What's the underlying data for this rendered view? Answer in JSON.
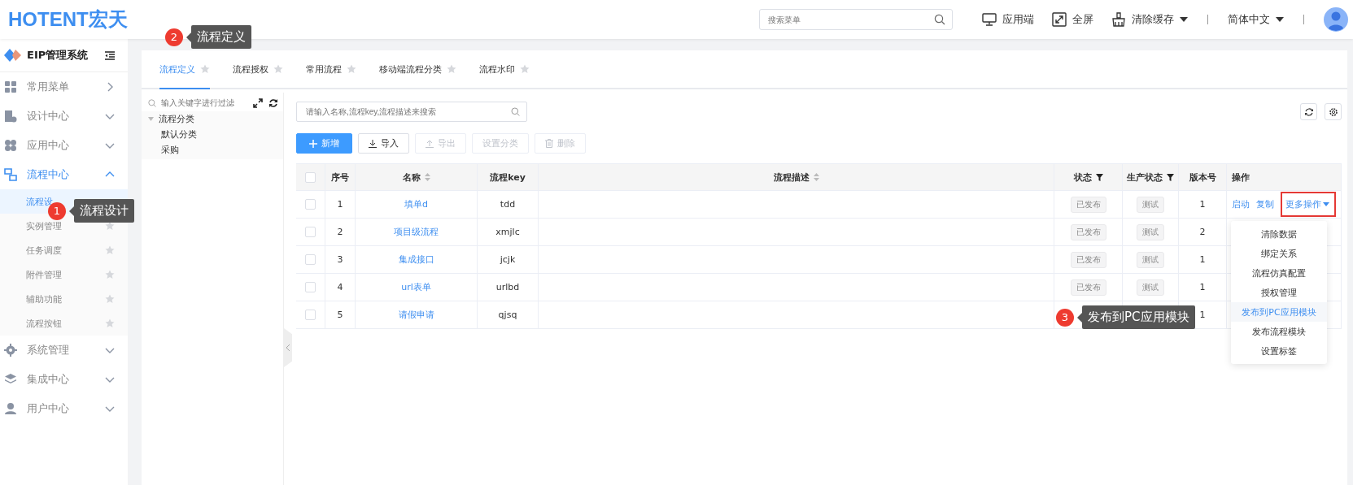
{
  "header": {
    "logo": "HOTENT宏天",
    "search": {
      "placeholder": "搜索菜单"
    },
    "actions": [
      {
        "kind": "monitor",
        "label": "应用端",
        "caret": false
      },
      {
        "kind": "fullscreen",
        "label": "全屏",
        "caret": false
      },
      {
        "kind": "broom",
        "label": "清除缓存",
        "caret": true
      },
      {
        "kind": "language",
        "label": "简体中文",
        "caret": true
      }
    ]
  },
  "sidebar": {
    "title": "EIP管理系统",
    "items": [
      {
        "kind": "link",
        "label": "常用菜单",
        "expanded": false,
        "selected": false
      },
      {
        "kind": "group",
        "label": "设计中心",
        "expanded": false,
        "selected": false
      },
      {
        "kind": "group",
        "label": "应用中心",
        "expanded": false,
        "selected": false
      },
      {
        "kind": "group",
        "label": "流程中心",
        "expanded": true,
        "selected": true,
        "children": [
          {
            "label": "流程设",
            "selected": true,
            "star": false
          },
          {
            "label": "实例管理",
            "selected": false,
            "star": true
          },
          {
            "label": "任务调度",
            "selected": false,
            "star": true
          },
          {
            "label": "附件管理",
            "selected": false,
            "star": true
          },
          {
            "label": "辅助功能",
            "selected": false,
            "star": true
          },
          {
            "label": "流程按钮",
            "selected": false,
            "star": true
          }
        ]
      },
      {
        "kind": "group",
        "label": "系统管理",
        "expanded": false,
        "selected": false
      },
      {
        "kind": "group",
        "label": "集成中心",
        "expanded": false,
        "selected": false
      },
      {
        "kind": "group",
        "label": "用户中心",
        "expanded": false,
        "selected": false
      }
    ]
  },
  "tabs": [
    {
      "label": "流程定义",
      "selected": true
    },
    {
      "label": "流程授权",
      "selected": false
    },
    {
      "label": "常用流程",
      "selected": false
    },
    {
      "label": "移动端流程分类",
      "selected": false
    },
    {
      "label": "流程水印",
      "selected": false
    }
  ],
  "tree": {
    "placeholder": "输入关键字进行过滤",
    "nodes": [
      {
        "label": "流程分类",
        "expanded": true,
        "children": [
          {
            "label": "默认分类"
          },
          {
            "label": "采购"
          }
        ]
      }
    ]
  },
  "search": {
    "placeholder": "请输入名称,流程key,流程描述来搜索"
  },
  "toolbar": [
    {
      "kind": "add",
      "label": "新增",
      "primary": true,
      "disabled": false
    },
    {
      "kind": "import",
      "label": "导入",
      "primary": false,
      "disabled": false
    },
    {
      "kind": "export",
      "label": "导出",
      "primary": false,
      "disabled": true
    },
    {
      "kind": "plain",
      "label": "设置分类",
      "primary": false,
      "disabled": true
    },
    {
      "kind": "delete",
      "label": "删除",
      "primary": false,
      "disabled": true
    }
  ],
  "table": {
    "all_checked": false,
    "columns": [
      {
        "label": "序号",
        "sortable": false,
        "filter": false
      },
      {
        "label": "名称",
        "sortable": true,
        "filter": false
      },
      {
        "label": "流程key",
        "sortable": false,
        "filter": false
      },
      {
        "label": "流程描述",
        "sortable": true,
        "filter": false
      },
      {
        "label": "状态",
        "sortable": false,
        "filter": true
      },
      {
        "label": "生产状态",
        "sortable": false,
        "filter": true
      },
      {
        "label": "版本号",
        "sortable": false,
        "filter": false
      },
      {
        "label": "操作",
        "sortable": false,
        "filter": false
      }
    ],
    "rows": [
      {
        "checked": false,
        "no": "1",
        "name": "填单d",
        "key": "tdd",
        "status": "已发布",
        "prod": "测试",
        "version": "1",
        "ops": [
          "启动",
          "复制"
        ],
        "more": "更多操作"
      },
      {
        "checked": false,
        "no": "2",
        "name": "项目级流程",
        "key": "xmjlc",
        "status": "已发布",
        "prod": "测试",
        "version": "2"
      },
      {
        "checked": false,
        "no": "3",
        "name": "集成接口",
        "key": "jcjk",
        "status": "已发布",
        "prod": "测试",
        "version": "1"
      },
      {
        "checked": false,
        "no": "4",
        "name": "url表单",
        "key": "urlbd",
        "status": "已发布",
        "prod": "测试",
        "version": "1"
      },
      {
        "checked": false,
        "no": "5",
        "name": "请假申请",
        "key": "qjsq",
        "version": "1"
      }
    ]
  },
  "dropdown": [
    {
      "label": "清除数据",
      "selected": false
    },
    {
      "label": "绑定关系",
      "selected": false
    },
    {
      "label": "流程仿真配置",
      "selected": false
    },
    {
      "label": "授权管理",
      "selected": false
    },
    {
      "label": "发布到PC应用模块",
      "selected": true
    },
    {
      "label": "发布流程模块",
      "selected": false
    },
    {
      "label": "设置标签",
      "selected": false
    }
  ],
  "annotations": [
    {
      "number": "1",
      "text": "流程设计"
    },
    {
      "number": "2",
      "text": "流程定义"
    },
    {
      "number": "3",
      "text": "发布到PC应用模块"
    }
  ]
}
